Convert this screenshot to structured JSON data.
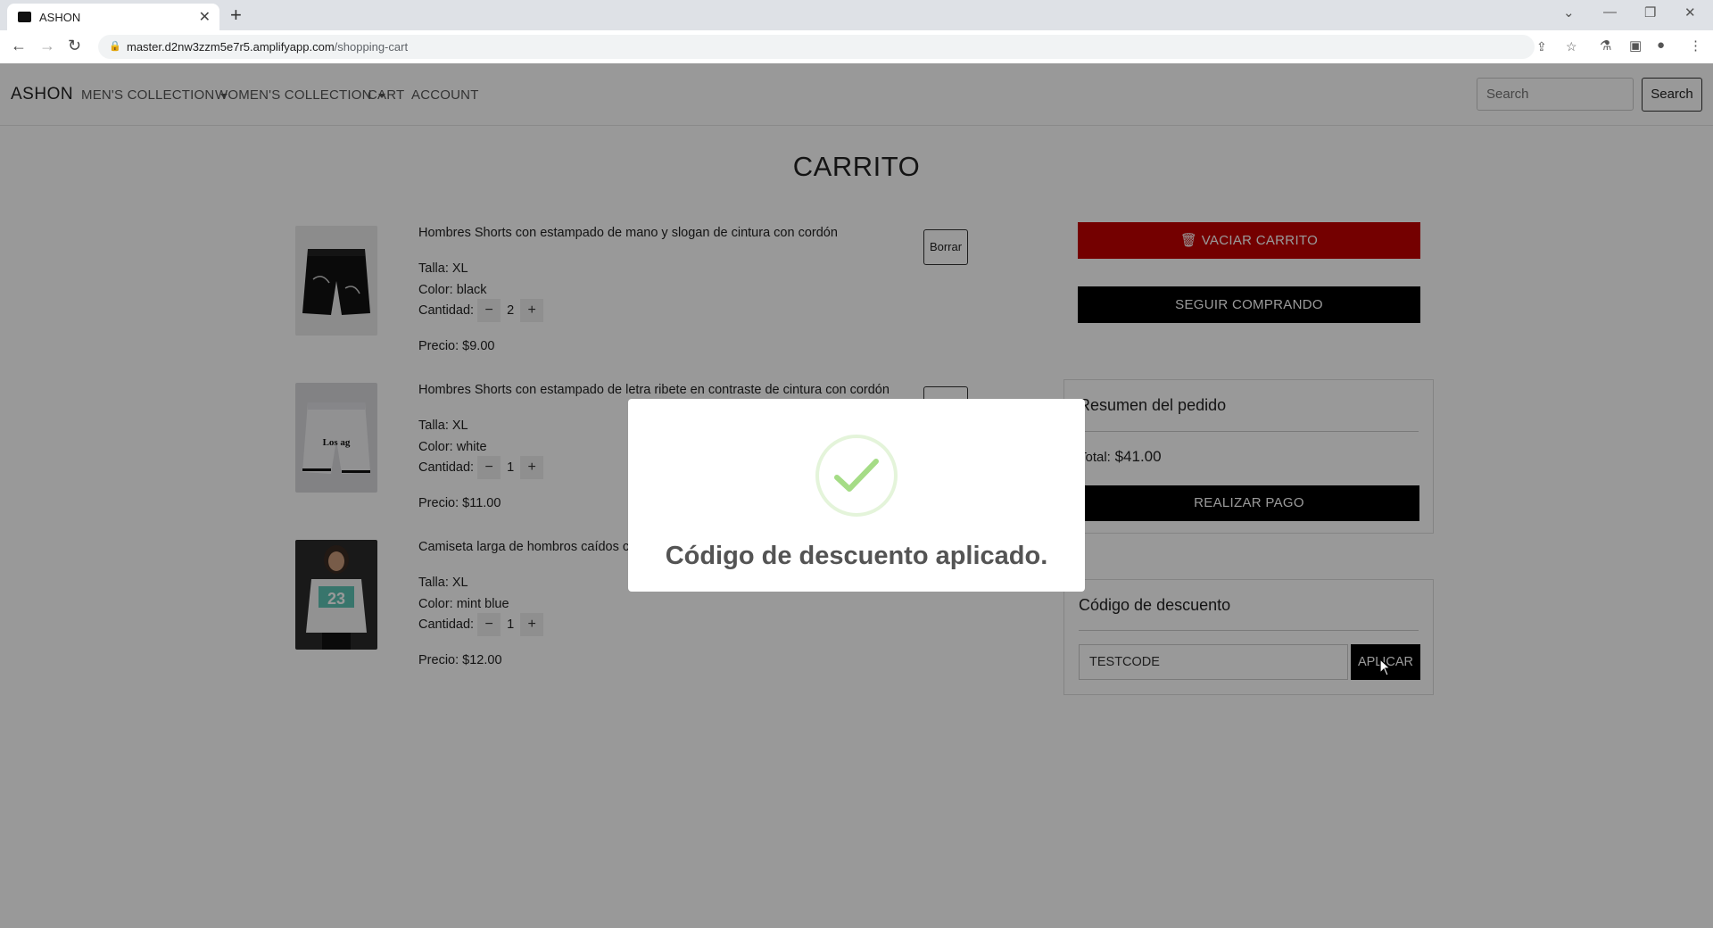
{
  "browser": {
    "tab_title": "ASHON",
    "url_host": "master.d2nw3zzm5e7r5.amplifyapp.com",
    "url_path": "/shopping-cart"
  },
  "navbar": {
    "brand": "ASHON",
    "links": [
      "MEN'S COLLECTION",
      "WOMEN'S COLLECTION",
      "CART",
      "ACCOUNT"
    ],
    "search_placeholder": "Search",
    "search_button": "Search"
  },
  "cart": {
    "title": "CARRITO",
    "items": [
      {
        "name": "Hombres Shorts con estampado de mano y slogan de cintura con cordón",
        "size": "Talla: XL",
        "color": "Color: black",
        "qty_label": "Cantidad:",
        "qty": "2",
        "price": "Precio: $9.00",
        "delete": "Borrar"
      },
      {
        "name": "Hombres Shorts con estampado de letra ribete en contraste de cintura con cordón",
        "size": "Talla: XL",
        "color": "Color: white",
        "qty_label": "Cantidad:",
        "qty": "1",
        "price": "Precio: $11.00"
      },
      {
        "name": "Camiseta larga de hombros caídos con",
        "size": "Talla: XL",
        "color": "Color: mint blue",
        "qty_label": "Cantidad:",
        "qty": "1",
        "price": "Precio: $12.00"
      }
    ],
    "qty_minus": "−",
    "qty_plus": "+",
    "empty_button": "VACIAR CARRITO",
    "continue_button": "SEGUIR COMPRANDO"
  },
  "summary": {
    "title": "Resumen del pedido",
    "total_label": "Total:",
    "total_value": "$41.00",
    "pay_button": "REALIZAR PAGO"
  },
  "discount": {
    "title": "Código de descuento",
    "code_value": "TESTCODE",
    "apply_button": "APLICAR"
  },
  "modal": {
    "message": "Código de descuento aplicado.",
    "icon": "success-check-icon"
  },
  "colors": {
    "danger": "#c10000",
    "primary_dark": "#000000",
    "success": "#a5dc86"
  }
}
